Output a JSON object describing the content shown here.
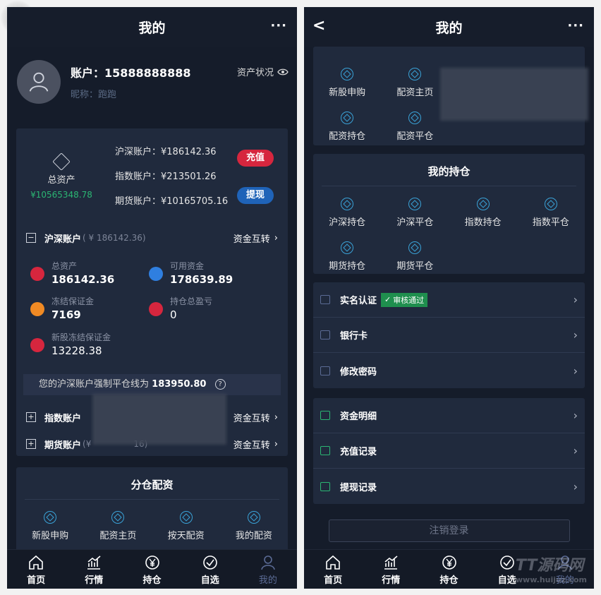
{
  "left": {
    "title": "我的",
    "more": "···",
    "account_label": "账户：15888888888",
    "nickname_label": "昵称：跑跑",
    "asset_status": "资产状况",
    "total_assets_label": "总资产",
    "total_assets_value": "¥10565348.78",
    "accounts": [
      {
        "text": "沪深账户：¥186142.36"
      },
      {
        "text": "指数账户：¥213501.26"
      },
      {
        "text": "期货账户：¥10165705.16"
      }
    ],
    "recharge": "充值",
    "withdraw": "提现",
    "hs_account": {
      "name": "沪深账户",
      "sub": "( ¥ 186142.36)",
      "transfer": "资金互转"
    },
    "metrics": [
      {
        "label": "总资产",
        "value": "186142.36",
        "color": "#d6263e"
      },
      {
        "label": "可用资金",
        "value": "178639.89",
        "color": "#2f7fe0"
      },
      {
        "label": "冻结保证金",
        "value": "7169",
        "color": "#f08a24"
      },
      {
        "label": "持仓总盈亏",
        "value": "0",
        "color": "#d6263e"
      },
      {
        "label": "新股冻结保证金",
        "value": "13228.38",
        "color": "#d6263e"
      }
    ],
    "notice_text": "您的沪深账户强制平仓线为",
    "notice_value": "183950.80",
    "qmark": "?",
    "index_account": {
      "name": "指数账户",
      "transfer": "资金互转"
    },
    "futures_account": {
      "name": "期货账户",
      "sub": "(¥",
      "sub2": "16)",
      "transfer": "资金互转"
    },
    "allocation": {
      "title": "分仓配资",
      "items": [
        "新股申购",
        "配资主页",
        "按天配资",
        "我的配资"
      ]
    }
  },
  "right": {
    "title": "我的",
    "back": "<",
    "more": "···",
    "allocation_items": [
      "新股申购",
      "配资主页",
      "配资持仓",
      "配资平仓"
    ],
    "holdings": {
      "title": "我的持仓",
      "items": [
        "沪深持仓",
        "沪深平仓",
        "指数持仓",
        "指数平仓",
        "期货持仓",
        "期货平仓"
      ]
    },
    "menu1": [
      {
        "label": "实名认证",
        "badge": "审核通过"
      },
      {
        "label": "银行卡"
      },
      {
        "label": "修改密码"
      }
    ],
    "menu2": [
      {
        "label": "资金明细"
      },
      {
        "label": "充值记录"
      },
      {
        "label": "提现记录"
      }
    ],
    "logout": "注销登录",
    "watermark": "TT源码网",
    "watermark_url": "www.huijuz.com"
  },
  "tabs": [
    {
      "label": "首页",
      "icon": "home-icon"
    },
    {
      "label": "行情",
      "icon": "chart-icon"
    },
    {
      "label": "持仓",
      "icon": "yuan-icon"
    },
    {
      "label": "自选",
      "icon": "check-icon"
    },
    {
      "label": "我的",
      "icon": "user-icon"
    }
  ],
  "colors": {
    "bg": "#151c2a",
    "card": "#202a3d",
    "green": "#2bb673",
    "red": "#d6263e",
    "blue": "#1f63b8",
    "accent": "#3aa3d8"
  }
}
